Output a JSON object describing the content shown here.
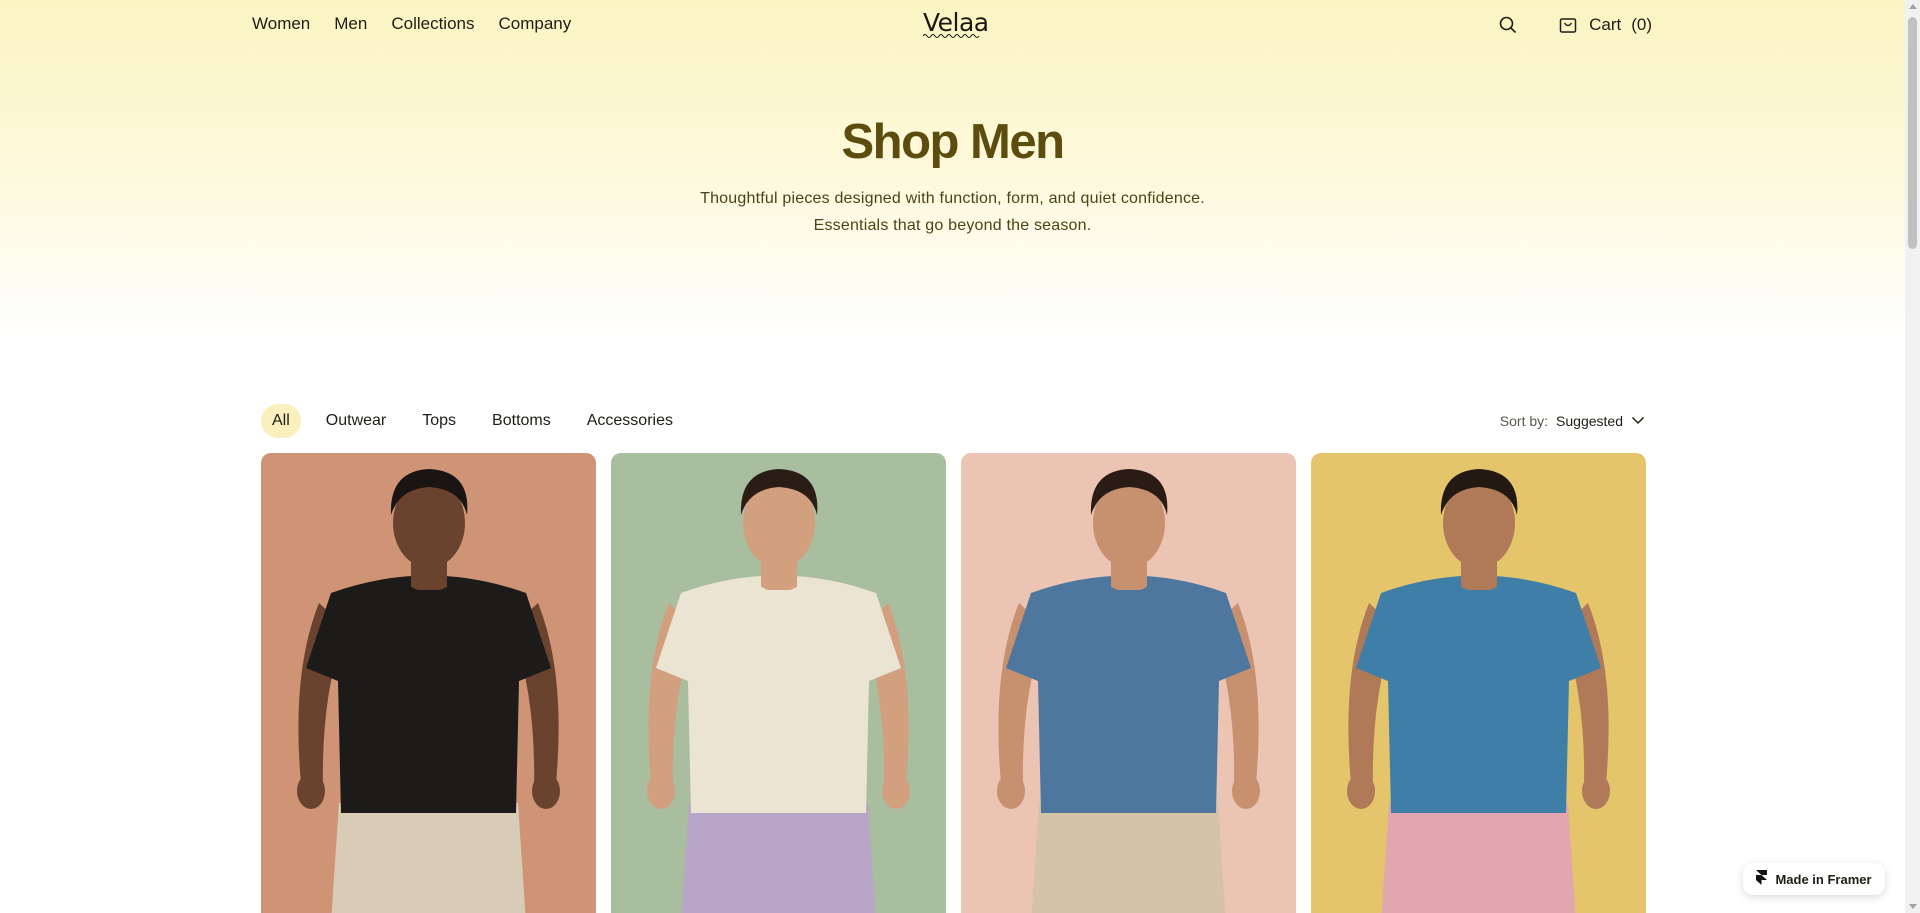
{
  "header": {
    "nav": [
      {
        "label": "Women"
      },
      {
        "label": "Men"
      },
      {
        "label": "Collections"
      },
      {
        "label": "Company"
      }
    ],
    "logo": "Velaa",
    "search_icon": "search-icon",
    "cart_icon": "bag-icon",
    "cart_label": "Cart",
    "cart_count": "(0)"
  },
  "hero": {
    "title": "Shop Men",
    "subtitle": "Thoughtful pieces designed with function, form, and quiet confidence. Essentials that go beyond the season."
  },
  "filters": {
    "items": [
      {
        "label": "All",
        "active": true
      },
      {
        "label": "Outwear"
      },
      {
        "label": "Tops"
      },
      {
        "label": "Bottoms"
      },
      {
        "label": "Accessories"
      }
    ],
    "sort_label": "Sort by:",
    "sort_value": "Suggested"
  },
  "products": [
    {
      "image": "man-black-tshirt",
      "bg": "#cf9476",
      "shirt": "#1d1b19",
      "pants": "#d9ccb6",
      "skin": "#6a432f",
      "hair": "#1a1412"
    },
    {
      "image": "man-cream-tshirt",
      "bg": "#a9bd9f",
      "shirt": "#ece4d3",
      "pants": "#b9a5c7",
      "skin": "#d29f7f",
      "hair": "#2a1d16"
    },
    {
      "image": "man-blue-tshirt-crossbody",
      "bg": "#ecc4b4",
      "shirt": "#4e77a0",
      "pants": "#d4c3a8",
      "skin": "#c7906e",
      "hair": "#2a1c15"
    },
    {
      "image": "man-blue-ruffle-top",
      "bg": "#e4c56c",
      "shirt": "#3f7fa7",
      "pants": "#e2a6ae",
      "skin": "#b07a58",
      "hair": "#231812"
    }
  ],
  "badge": {
    "label": "Made in Framer",
    "icon": "framer-icon"
  }
}
